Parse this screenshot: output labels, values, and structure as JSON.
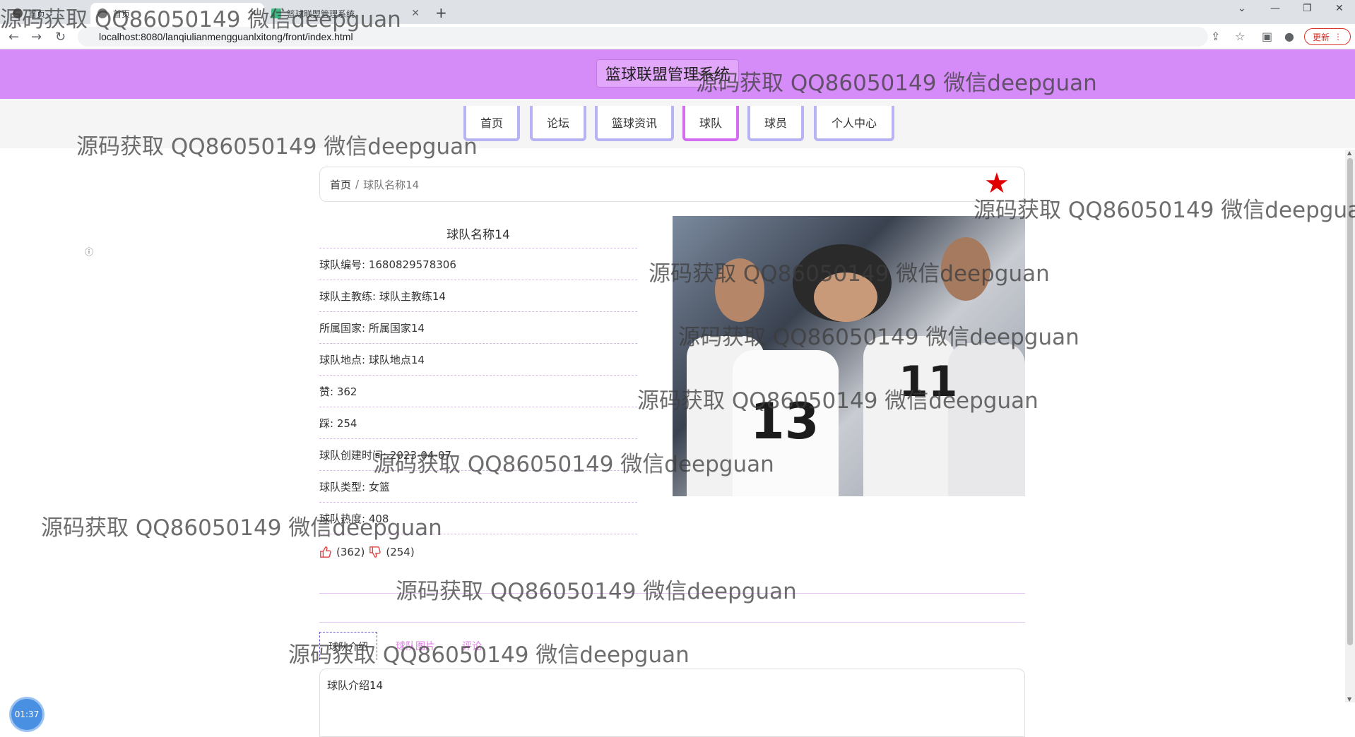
{
  "browser": {
    "tabs": [
      {
        "label": "首页",
        "active": false
      },
      {
        "label": "首页",
        "active": true
      },
      {
        "label": "篮球联盟管理系统",
        "active": false
      }
    ],
    "url": "localhost:8080/lanqiulianmengguanlxitong/front/index.html",
    "update_label": "更新"
  },
  "site": {
    "title": "篮球联盟管理系统"
  },
  "nav": {
    "items": [
      "首页",
      "论坛",
      "篮球资讯",
      "球队",
      "球员",
      "个人中心"
    ],
    "active": "球队"
  },
  "breadcrumb": {
    "home": "首页",
    "separator": "/",
    "current": "球队名称14"
  },
  "team": {
    "title": "球队名称14",
    "fields": [
      "球队编号: 1680829578306",
      "球队主教练: 球队主教练14",
      "所属国家: 所属国家14",
      "球队地点: 球队地点14",
      "赞: 362",
      "踩: 254",
      "球队创建时间: 2023-04-07",
      "球队类型: 女篮",
      "球队热度: 408"
    ],
    "likes": "(362)",
    "dislikes": "(254)"
  },
  "detail_tabs": [
    "球队介绍",
    "球队图片",
    "评论"
  ],
  "intro_text": "球队介绍14",
  "timer": "01:37",
  "watermark": "源码获取 QQ86050149 微信deepguan",
  "colors": {
    "header": "#d68cf8",
    "nav_border": "#b8b4f4",
    "nav_active": "#d36ef0",
    "star": "#e00000"
  }
}
